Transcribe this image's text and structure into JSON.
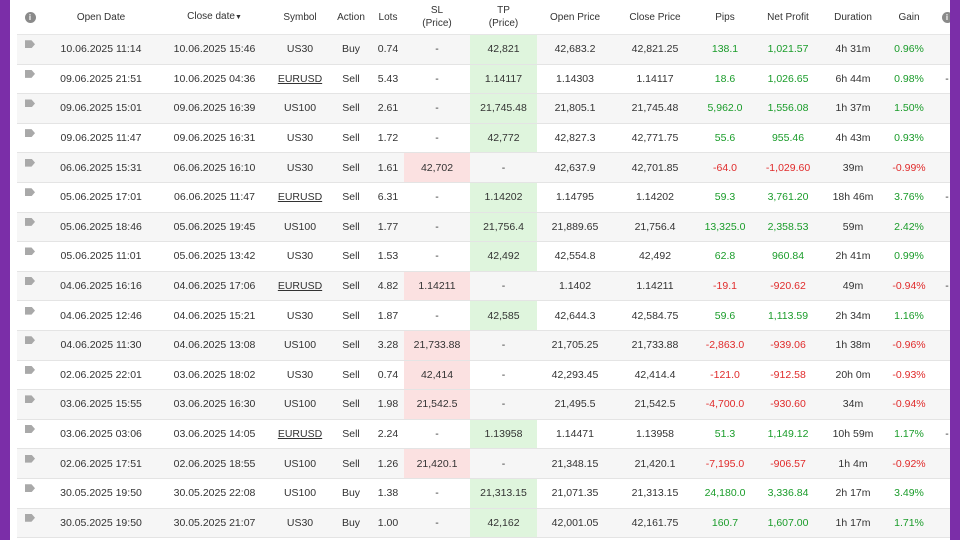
{
  "headers": {
    "open_date": "Open Date",
    "close_date": "Close date",
    "symbol": "Symbol",
    "action": "Action",
    "lots": "Lots",
    "sl_top": "SL",
    "sl_bottom": "(Price)",
    "tp_top": "TP",
    "tp_bottom": "(Price)",
    "open_price": "Open Price",
    "close_price": "Close Price",
    "pips": "Pips",
    "net_profit": "Net Profit",
    "duration": "Duration",
    "gain": "Gain",
    "info_glyph": "i",
    "sort_glyph": "▼"
  },
  "rows": [
    {
      "open": "10.06.2025 11:14",
      "close": "10.06.2025 15:46",
      "symbol": "US30",
      "action": "Buy",
      "lots": "0.74",
      "sl": "-",
      "tp": "42,821",
      "open_price": "42,683.2",
      "close_price": "42,821.25",
      "pips": "138.1",
      "profit": "1,021.57",
      "duration": "4h 31m",
      "gain": "0.96%",
      "extra": "",
      "outcome": "tp",
      "sign": "pos",
      "symbol_link": false
    },
    {
      "open": "09.06.2025 21:51",
      "close": "10.06.2025 04:36",
      "symbol": "EURUSD",
      "action": "Sell",
      "lots": "5.43",
      "sl": "-",
      "tp": "1.14117",
      "open_price": "1.14303",
      "close_price": "1.14117",
      "pips": "18.6",
      "profit": "1,026.65",
      "duration": "6h 44m",
      "gain": "0.98%",
      "extra": "-",
      "outcome": "tp",
      "sign": "pos",
      "symbol_link": true
    },
    {
      "open": "09.06.2025 15:01",
      "close": "09.06.2025 16:39",
      "symbol": "US100",
      "action": "Sell",
      "lots": "2.61",
      "sl": "-",
      "tp": "21,745.48",
      "open_price": "21,805.1",
      "close_price": "21,745.48",
      "pips": "5,962.0",
      "profit": "1,556.08",
      "duration": "1h 37m",
      "gain": "1.50%",
      "extra": "",
      "outcome": "tp",
      "sign": "pos",
      "symbol_link": false
    },
    {
      "open": "09.06.2025 11:47",
      "close": "09.06.2025 16:31",
      "symbol": "US30",
      "action": "Sell",
      "lots": "1.72",
      "sl": "-",
      "tp": "42,772",
      "open_price": "42,827.3",
      "close_price": "42,771.75",
      "pips": "55.6",
      "profit": "955.46",
      "duration": "4h 43m",
      "gain": "0.93%",
      "extra": "",
      "outcome": "tp",
      "sign": "pos",
      "symbol_link": false
    },
    {
      "open": "06.06.2025 15:31",
      "close": "06.06.2025 16:10",
      "symbol": "US30",
      "action": "Sell",
      "lots": "1.61",
      "sl": "42,702",
      "tp": "-",
      "open_price": "42,637.9",
      "close_price": "42,701.85",
      "pips": "-64.0",
      "profit": "-1,029.60",
      "duration": "39m",
      "gain": "-0.99%",
      "extra": "",
      "outcome": "sl",
      "sign": "neg",
      "symbol_link": false
    },
    {
      "open": "05.06.2025 17:01",
      "close": "06.06.2025 11:47",
      "symbol": "EURUSD",
      "action": "Sell",
      "lots": "6.31",
      "sl": "-",
      "tp": "1.14202",
      "open_price": "1.14795",
      "close_price": "1.14202",
      "pips": "59.3",
      "profit": "3,761.20",
      "duration": "18h 46m",
      "gain": "3.76%",
      "extra": "-",
      "outcome": "tp",
      "sign": "pos",
      "symbol_link": true
    },
    {
      "open": "05.06.2025 18:46",
      "close": "05.06.2025 19:45",
      "symbol": "US100",
      "action": "Sell",
      "lots": "1.77",
      "sl": "-",
      "tp": "21,756.4",
      "open_price": "21,889.65",
      "close_price": "21,756.4",
      "pips": "13,325.0",
      "profit": "2,358.53",
      "duration": "59m",
      "gain": "2.42%",
      "extra": "",
      "outcome": "tp",
      "sign": "pos",
      "symbol_link": false
    },
    {
      "open": "05.06.2025 11:01",
      "close": "05.06.2025 13:42",
      "symbol": "US30",
      "action": "Sell",
      "lots": "1.53",
      "sl": "-",
      "tp": "42,492",
      "open_price": "42,554.8",
      "close_price": "42,492",
      "pips": "62.8",
      "profit": "960.84",
      "duration": "2h 41m",
      "gain": "0.99%",
      "extra": "",
      "outcome": "tp",
      "sign": "pos",
      "symbol_link": false
    },
    {
      "open": "04.06.2025 16:16",
      "close": "04.06.2025 17:06",
      "symbol": "EURUSD",
      "action": "Sell",
      "lots": "4.82",
      "sl": "1.14211",
      "tp": "-",
      "open_price": "1.1402",
      "close_price": "1.14211",
      "pips": "-19.1",
      "profit": "-920.62",
      "duration": "49m",
      "gain": "-0.94%",
      "extra": "-",
      "outcome": "sl",
      "sign": "neg",
      "symbol_link": true
    },
    {
      "open": "04.06.2025 12:46",
      "close": "04.06.2025 15:21",
      "symbol": "US30",
      "action": "Sell",
      "lots": "1.87",
      "sl": "-",
      "tp": "42,585",
      "open_price": "42,644.3",
      "close_price": "42,584.75",
      "pips": "59.6",
      "profit": "1,113.59",
      "duration": "2h 34m",
      "gain": "1.16%",
      "extra": "",
      "outcome": "tp",
      "sign": "pos",
      "symbol_link": false
    },
    {
      "open": "04.06.2025 11:30",
      "close": "04.06.2025 13:08",
      "symbol": "US100",
      "action": "Sell",
      "lots": "3.28",
      "sl": "21,733.88",
      "tp": "-",
      "open_price": "21,705.25",
      "close_price": "21,733.88",
      "pips": "-2,863.0",
      "profit": "-939.06",
      "duration": "1h 38m",
      "gain": "-0.96%",
      "extra": "",
      "outcome": "sl",
      "sign": "neg",
      "symbol_link": false
    },
    {
      "open": "02.06.2025 22:01",
      "close": "03.06.2025 18:02",
      "symbol": "US30",
      "action": "Sell",
      "lots": "0.74",
      "sl": "42,414",
      "tp": "-",
      "open_price": "42,293.45",
      "close_price": "42,414.4",
      "pips": "-121.0",
      "profit": "-912.58",
      "duration": "20h 0m",
      "gain": "-0.93%",
      "extra": "",
      "outcome": "sl",
      "sign": "neg",
      "symbol_link": false
    },
    {
      "open": "03.06.2025 15:55",
      "close": "03.06.2025 16:30",
      "symbol": "US100",
      "action": "Sell",
      "lots": "1.98",
      "sl": "21,542.5",
      "tp": "-",
      "open_price": "21,495.5",
      "close_price": "21,542.5",
      "pips": "-4,700.0",
      "profit": "-930.60",
      "duration": "34m",
      "gain": "-0.94%",
      "extra": "",
      "outcome": "sl",
      "sign": "neg",
      "symbol_link": false
    },
    {
      "open": "03.06.2025 03:06",
      "close": "03.06.2025 14:05",
      "symbol": "EURUSD",
      "action": "Sell",
      "lots": "2.24",
      "sl": "-",
      "tp": "1.13958",
      "open_price": "1.14471",
      "close_price": "1.13958",
      "pips": "51.3",
      "profit": "1,149.12",
      "duration": "10h 59m",
      "gain": "1.17%",
      "extra": "-",
      "outcome": "tp",
      "sign": "pos",
      "symbol_link": true
    },
    {
      "open": "02.06.2025 17:51",
      "close": "02.06.2025 18:55",
      "symbol": "US100",
      "action": "Sell",
      "lots": "1.26",
      "sl": "21,420.1",
      "tp": "-",
      "open_price": "21,348.15",
      "close_price": "21,420.1",
      "pips": "-7,195.0",
      "profit": "-906.57",
      "duration": "1h 4m",
      "gain": "-0.92%",
      "extra": "",
      "outcome": "sl",
      "sign": "neg",
      "symbol_link": false
    },
    {
      "open": "30.05.2025 19:50",
      "close": "30.05.2025 22:08",
      "symbol": "US100",
      "action": "Buy",
      "lots": "1.38",
      "sl": "-",
      "tp": "21,313.15",
      "open_price": "21,071.35",
      "close_price": "21,313.15",
      "pips": "24,180.0",
      "profit": "3,336.84",
      "duration": "2h 17m",
      "gain": "3.49%",
      "extra": "",
      "outcome": "tp",
      "sign": "pos",
      "symbol_link": false
    },
    {
      "open": "30.05.2025 19:50",
      "close": "30.05.2025 21:07",
      "symbol": "US30",
      "action": "Buy",
      "lots": "1.00",
      "sl": "-",
      "tp": "42,162",
      "open_price": "42,001.05",
      "close_price": "42,161.75",
      "pips": "160.7",
      "profit": "1,607.00",
      "duration": "1h 17m",
      "gain": "1.71%",
      "extra": "",
      "outcome": "tp",
      "sign": "pos",
      "symbol_link": false
    }
  ]
}
